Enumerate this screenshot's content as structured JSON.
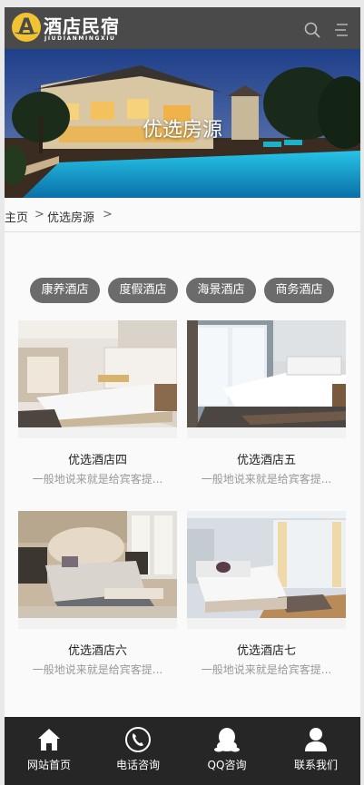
{
  "header": {
    "logo_letter": "A",
    "brand": "酒店民宿",
    "brand_sub": "JIUDIANMINGXIU",
    "search_icon": "search-icon",
    "menu_icon": "menu-icon"
  },
  "banner": {
    "title": "优选房源"
  },
  "breadcrumb": {
    "items": [
      "主页",
      "优选房源"
    ],
    "separator": ">"
  },
  "tags": [
    "康养酒店",
    "度假酒店",
    "海景酒店",
    "商务酒店"
  ],
  "cards": [
    {
      "title": "优选酒店四",
      "desc": "一般地说来就是给宾客提..."
    },
    {
      "title": "优选酒店五",
      "desc": "一般地说来就是给宾客提..."
    },
    {
      "title": "优选酒店六",
      "desc": "一般地说来就是给宾客提..."
    },
    {
      "title": "优选酒店七",
      "desc": "一般地说来就是给宾客提..."
    }
  ],
  "footer": {
    "items": [
      {
        "label": "网站首页",
        "icon": "home-icon"
      },
      {
        "label": "电话咨询",
        "icon": "phone-icon"
      },
      {
        "label": "QQ咨询",
        "icon": "qq-icon"
      },
      {
        "label": "联系我们",
        "icon": "user-icon"
      }
    ]
  },
  "colors": {
    "header_bg": "#4a4a4a",
    "logo": "#f1c232",
    "tag_bg": "#6b6b6b",
    "footer_bg": "#262626"
  }
}
